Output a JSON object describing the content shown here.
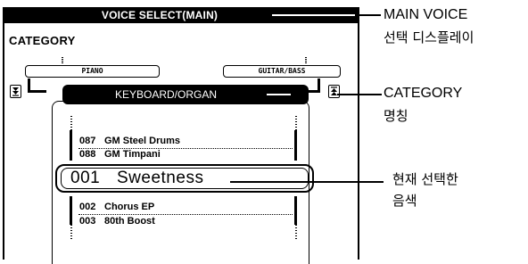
{
  "title_bar": {
    "label": "VOICE SELECT(MAIN)"
  },
  "category": {
    "heading": "CATEGORY",
    "prev_category": "PIANO",
    "next_category": "GUITAR/BASS",
    "current_category": "KEYBOARD/ORGAN"
  },
  "voice_list": {
    "above": [
      {
        "number": "087",
        "name": "GM Steel Drums"
      },
      {
        "number": "088",
        "name": "GM Timpani"
      }
    ],
    "current": {
      "number": "001",
      "name": "Sweetness"
    },
    "below": [
      {
        "number": "002",
        "name": "Chorus EP"
      },
      {
        "number": "003",
        "name": "80th Boost"
      }
    ]
  },
  "callouts": {
    "main_voice": {
      "line1": "MAIN VOICE",
      "line2": "선택 디스플레이"
    },
    "category": {
      "line1": "CATEGORY",
      "line2": "명칭"
    },
    "current_voice": {
      "line1": "현재 선택한",
      "line2": "음색"
    }
  },
  "icons": {
    "scroll_down": "arrow-down-bar-icon",
    "scroll_up": "arrow-up-bar-icon"
  }
}
